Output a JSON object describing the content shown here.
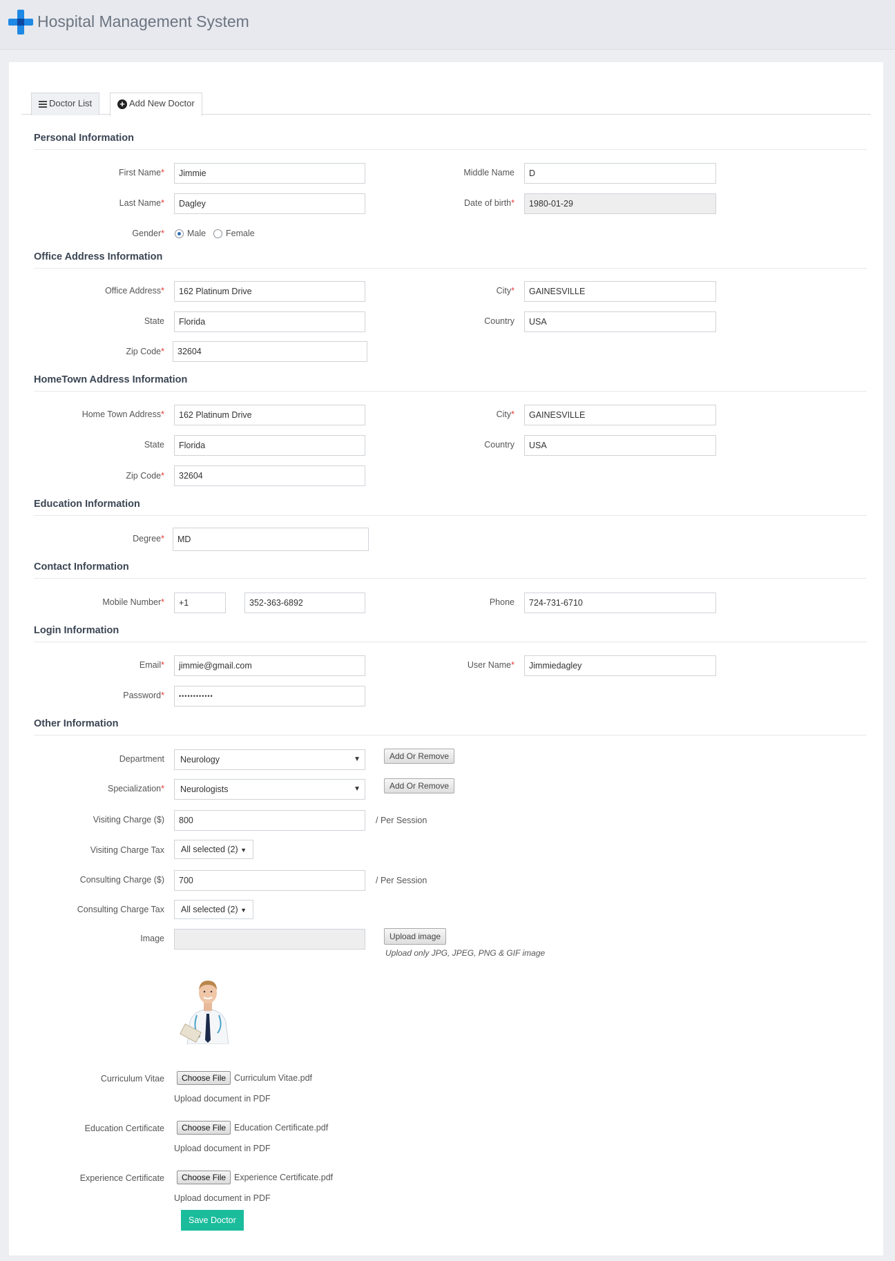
{
  "app": {
    "title": "Hospital Management System"
  },
  "tabs": [
    {
      "label": "Doctor List"
    },
    {
      "label": "Add New Doctor"
    }
  ],
  "sections": {
    "personal": "Personal Information",
    "office": "Office Address Information",
    "hometown": "HomeTown Address Information",
    "education": "Education Information",
    "contact": "Contact Information",
    "login": "Login Information",
    "other": "Other Information"
  },
  "personal": {
    "first_name_label": "First Name",
    "first_name": "Jimmie",
    "middle_name_label": "Middle Name",
    "middle_name": "D",
    "last_name_label": "Last Name",
    "last_name": "Dagley",
    "dob_label": "Date of birth",
    "dob": "1980-01-29",
    "gender_label": "Gender",
    "gender_male": "Male",
    "gender_female": "Female"
  },
  "office": {
    "address_label": "Office Address",
    "address": "162  Platinum Drive",
    "city_label": "City",
    "city": "GAINESVILLE",
    "state_label": "State",
    "state": "Florida",
    "country_label": "Country",
    "country": "USA",
    "zip_label": "Zip Code",
    "zip": "32604"
  },
  "hometown": {
    "address_label": "Home Town Address",
    "address": "162  Platinum Drive",
    "city_label": "City",
    "city": "GAINESVILLE",
    "state_label": "State",
    "state": "Florida",
    "country_label": "Country",
    "country": "USA",
    "zip_label": "Zip Code",
    "zip": "32604"
  },
  "education": {
    "degree_label": "Degree",
    "degree": "MD"
  },
  "contact": {
    "mobile_label": "Mobile Number",
    "mobile_code": "+1",
    "mobile": "352-363-6892",
    "phone_label": "Phone",
    "phone": "724-731-6710"
  },
  "login": {
    "email_label": "Email",
    "email": "jimmie@gmail.com",
    "username_label": "User Name",
    "username": "Jimmiedagley",
    "password_label": "Password",
    "password": "••••••••••••"
  },
  "other": {
    "department_label": "Department",
    "department": "Neurology",
    "specialization_label": "Specialization",
    "specialization": "Neurologists",
    "add_remove": "Add Or Remove",
    "visiting_charge_label": "Visiting Charge ($)",
    "visiting_charge": "800",
    "per_session": "/ Per Session",
    "visiting_tax_label": "Visiting Charge Tax",
    "visiting_tax": "All selected (2)",
    "consulting_charge_label": "Consulting Charge ($)",
    "consulting_charge": "700",
    "consulting_tax_label": "Consulting Charge Tax",
    "consulting_tax": "All selected (2)",
    "image_label": "Image",
    "upload_image": "Upload image",
    "upload_hint": "Upload only JPG, JPEG, PNG & GIF image",
    "cv_label": "Curriculum Vitae",
    "cv_file": "Curriculum Vitae.pdf",
    "edu_cert_label": "Education Certificate",
    "edu_cert_file": "Education Certificate.pdf",
    "exp_cert_label": "Experience Certificate",
    "exp_cert_file": "Experience Certificate.pdf",
    "choose_file": "Choose File",
    "pdf_hint": "Upload document in PDF"
  },
  "actions": {
    "save": "Save Doctor"
  },
  "colors": {
    "accent": "#1abc9c",
    "brand": "#1e88e5",
    "required": "#e53935"
  }
}
